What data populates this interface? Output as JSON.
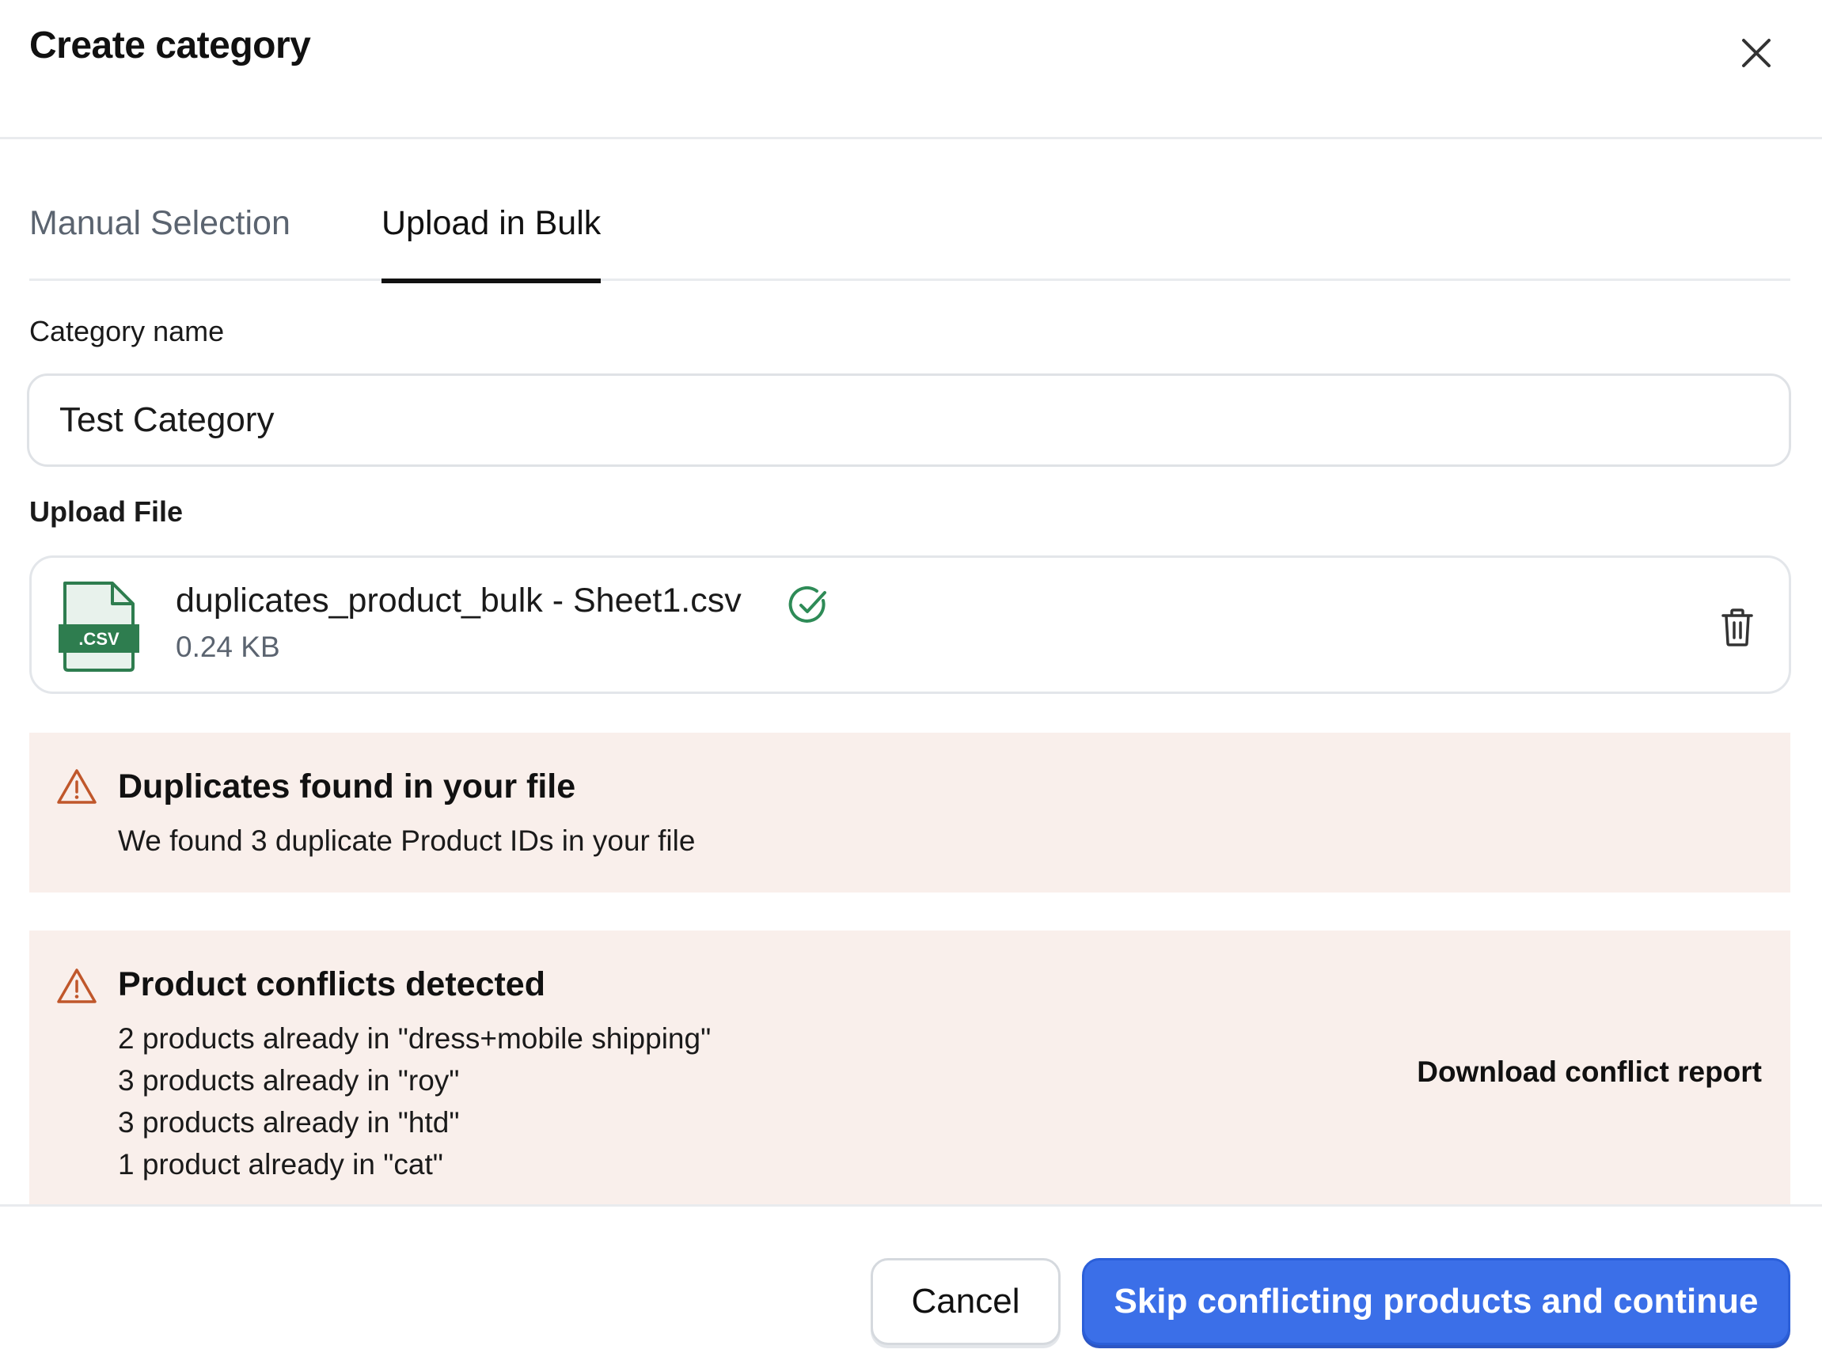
{
  "dialog": {
    "title": "Create category"
  },
  "tabs": [
    {
      "label": "Manual Selection",
      "active": false
    },
    {
      "label": "Upload in Bulk",
      "active": true
    }
  ],
  "category": {
    "label": "Category name",
    "value": "Test Category"
  },
  "upload": {
    "label": "Upload File",
    "file_badge": ".CSV",
    "file_name": "duplicates_product_bulk - Sheet1.csv",
    "file_size": "0.24 KB"
  },
  "alerts": {
    "duplicates": {
      "title": "Duplicates found in your file",
      "text": "We found 3 duplicate Product IDs in your file"
    },
    "conflicts": {
      "title": "Product conflicts detected",
      "lines": [
        "2 products already in \"dress+mobile shipping\"",
        "3 products already in \"roy\"",
        "3 products already in \"htd\"",
        "1 product already in \"cat\""
      ],
      "download_label": "Download conflict report"
    }
  },
  "footer": {
    "cancel_label": "Cancel",
    "primary_label": "Skip conflicting products and continue"
  },
  "colors": {
    "primary": "#3b6fe8",
    "alert_bg": "#f9efeb",
    "warning": "#c0572b",
    "success": "#2e8b57",
    "csv_green": "#2e7d4f"
  }
}
